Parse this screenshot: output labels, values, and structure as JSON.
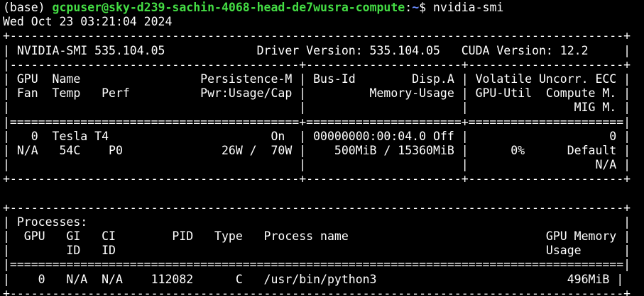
{
  "prompt": {
    "env": "(base) ",
    "user_host": "gcpuser@sky-d239-sachin-4068-head-de7wusra-compute",
    "separator": ":",
    "path": "~",
    "symbol": "$ ",
    "command": "nvidia-smi"
  },
  "output_lines": [
    "Wed Oct 23 03:21:04 2024",
    "+---------------------------------------------------------------------------------------+",
    "| NVIDIA-SMI 535.104.05             Driver Version: 535.104.05   CUDA Version: 12.2     |",
    "|-----------------------------------------+----------------------+----------------------+",
    "| GPU  Name                 Persistence-M | Bus-Id        Disp.A | Volatile Uncorr. ECC |",
    "| Fan  Temp   Perf          Pwr:Usage/Cap |         Memory-Usage | GPU-Util  Compute M. |",
    "|                                         |                      |               MIG M. |",
    "|=========================================+======================+======================|",
    "|   0  Tesla T4                       On  | 00000000:00:04.0 Off |                    0 |",
    "| N/A   54C    P0              26W /  70W |    500MiB / 15360MiB |      0%      Default |",
    "|                                         |                      |                  N/A |",
    "+-----------------------------------------+----------------------+----------------------+",
    "",
    "+---------------------------------------------------------------------------------------+",
    "| Processes:                                                                            |",
    "|  GPU   GI   CI        PID   Type   Process name                            GPU Memory |",
    "|        ID   ID                                                             Usage      |",
    "|=======================================================================================|",
    "|    0   N/A  N/A    112082      C   /usr/bin/python3                           496MiB |",
    "+---------------------------------------------------------------------------------------+"
  ]
}
